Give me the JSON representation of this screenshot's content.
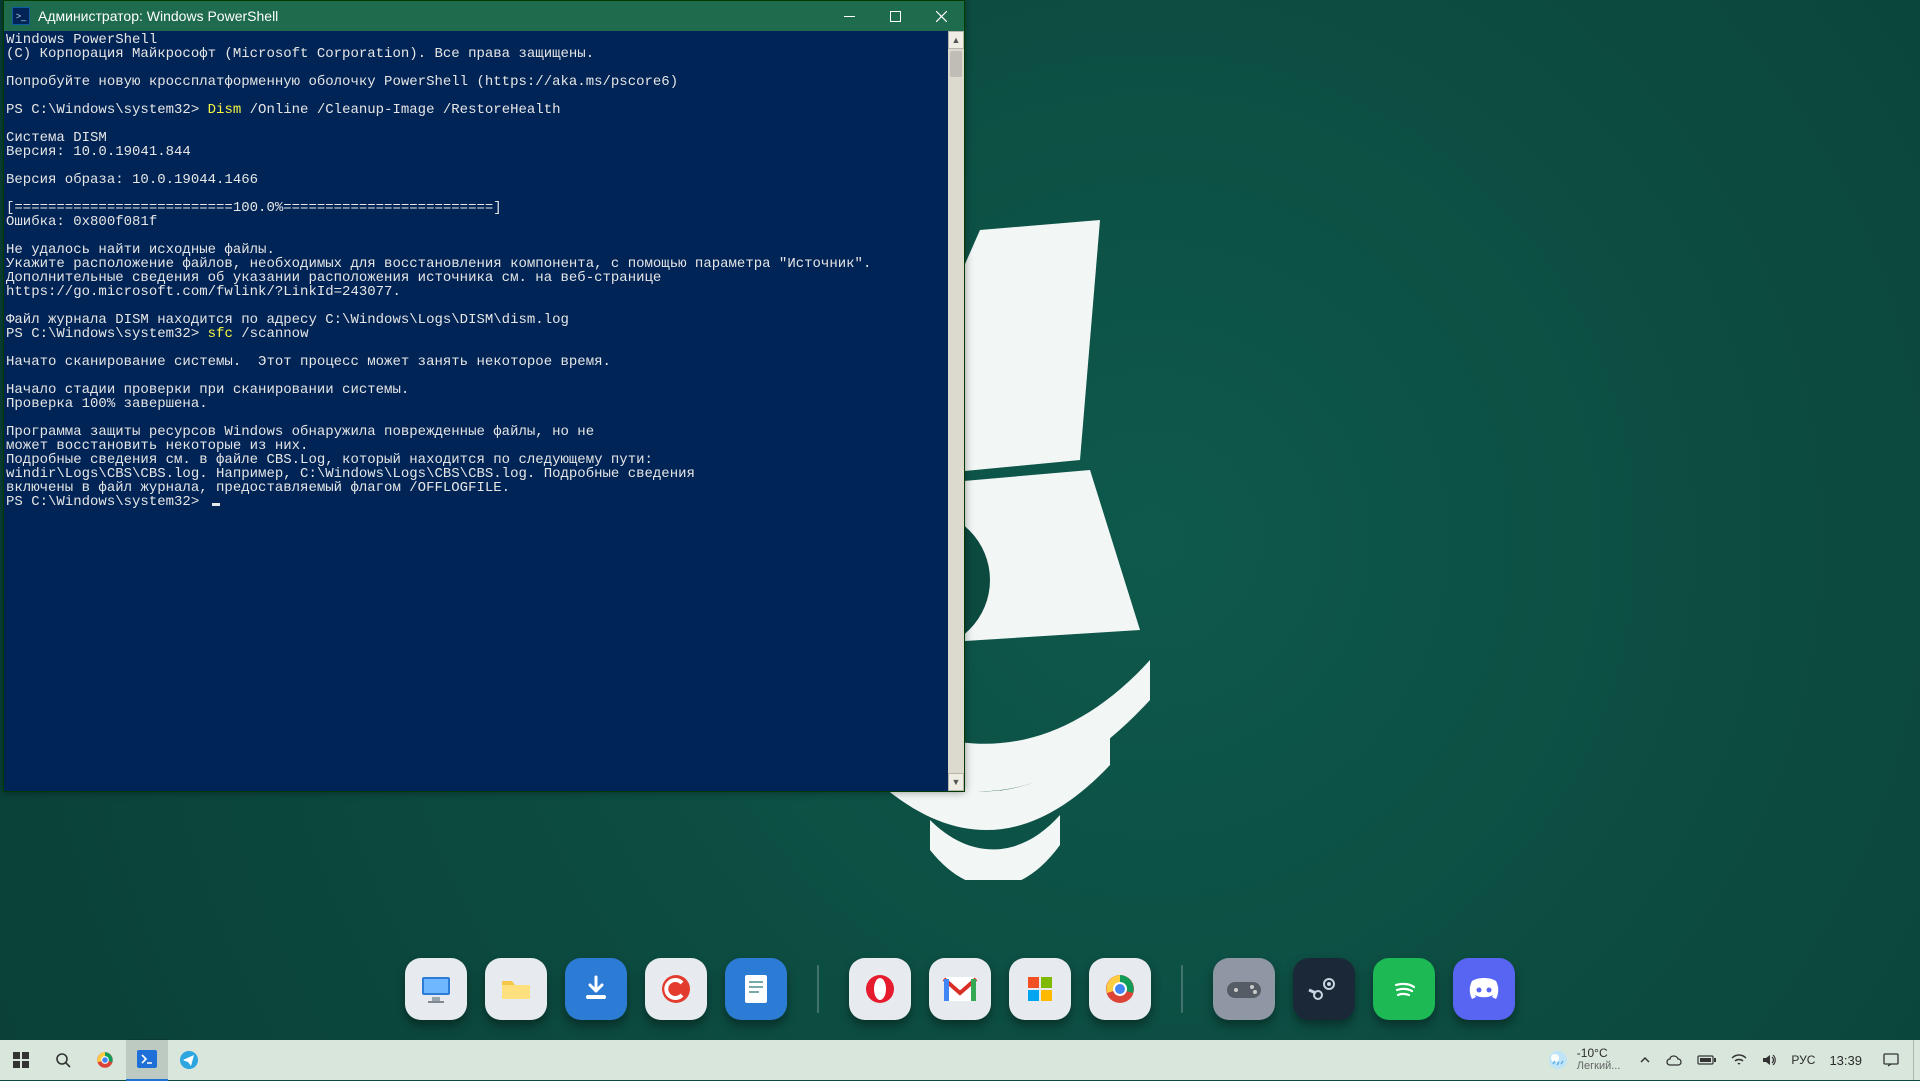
{
  "window": {
    "title": "Администратор: Windows PowerShell"
  },
  "terminal": {
    "line1": "Windows PowerShell",
    "line2": "(C) Корпорация Майкрософт (Microsoft Corporation). Все права защищены.",
    "line3": "Попробуйте новую кроссплатформенную оболочку PowerShell (https://aka.ms/pscore6)",
    "prompt1_prefix": "PS C:\\Windows\\system32> ",
    "cmd1_highlight": "Dism",
    "cmd1_rest": " /Online /Cleanup-Image /RestoreHealth",
    "dism1": "Cистема DISM",
    "dism2": "Версия: 10.0.19041.844",
    "dism3": "Версия образа: 10.0.19044.1466",
    "dism4": "[==========================100.0%=========================]",
    "dism5": "Ошибка: 0x800f081f",
    "dism6": "Не удалось найти исходные файлы.",
    "dism7": "Укажите расположение файлов, необходимых для восстановления компонента, с помощью параметра \"Источник\". Дополнительные сведения об указании расположения источника см. на веб-странице https://go.microsoft.com/fwlink/?LinkId=243077.",
    "dism8": "Файл журнала DISM находится по адресу C:\\Windows\\Logs\\DISM\\dism.log",
    "prompt2_prefix": "PS C:\\Windows\\system32> ",
    "cmd2_highlight": "sfc",
    "cmd2_rest": " /scannow",
    "sfc1": "Начато сканирование системы.  Этот процесс может занять некоторое время.",
    "sfc2": "Начало стадии проверки при сканировании системы.",
    "sfc3": "Проверка 100% завершена.",
    "sfc4": "Программа защиты ресурсов Windows обнаружила поврежденные файлы, но не",
    "sfc5": "может восстановить некоторые из них.",
    "sfc6": "Подробные сведения см. в файле CBS.Log, который находится по следующему пути:",
    "sfc7": "windir\\Logs\\CBS\\CBS.log. Например, C:\\Windows\\Logs\\CBS\\CBS.log. Подробные сведения",
    "sfc8": "включены в файл журнала, предоставляемый флагом /OFFLOGFILE.",
    "prompt3": "PS C:\\Windows\\system32> "
  },
  "dock": {
    "items_a": [
      "this-pc",
      "file-explorer",
      "downloads",
      "ccleaner",
      "notepad"
    ],
    "items_b": [
      "opera",
      "gmail",
      "microsoft-store",
      "chrome"
    ],
    "items_c": [
      "games",
      "steam",
      "spotify",
      "discord"
    ]
  },
  "taskbar": {
    "start": "Пуск",
    "search": "Поиск",
    "weather_temp": "-10°C",
    "weather_desc": "Легкий...",
    "lang": "РУС",
    "time": "13:39"
  }
}
